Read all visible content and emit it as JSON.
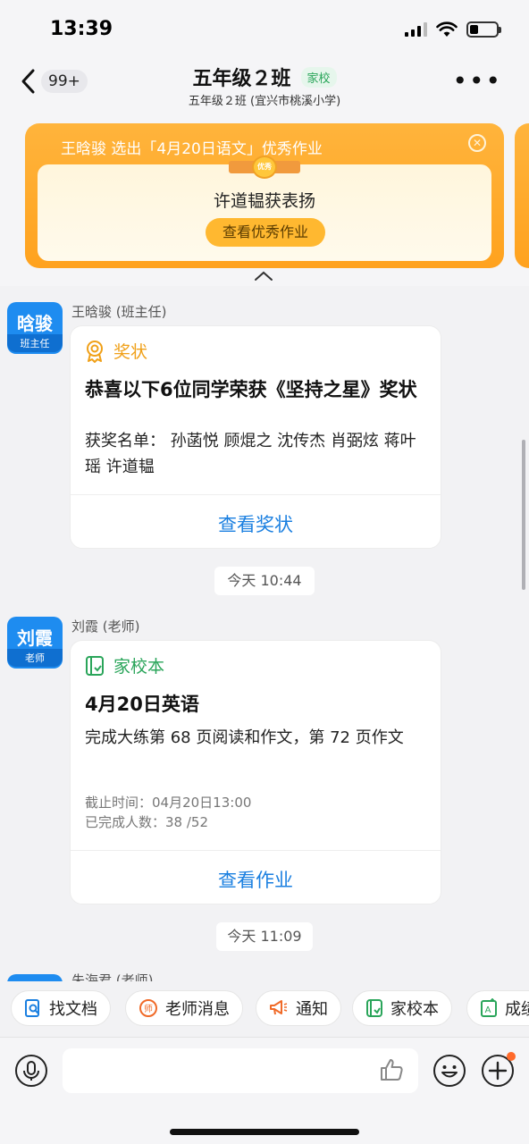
{
  "status_bar": {
    "time": "13:39"
  },
  "nav": {
    "back_badge": "99+",
    "title": "五年级２班",
    "tag": "家校",
    "subtitle": "五年级２班 (宜兴市桃溪小学)"
  },
  "banner": {
    "headline": "王晗骏 选出「4月20日语文」优秀作业",
    "ribbon_label": "优秀",
    "praise": "许道韫获表扬",
    "button_label": "查看优秀作业"
  },
  "messages": [
    {
      "avatar_name": "晗骏",
      "avatar_role": "班主任",
      "sender": "王晗骏 (班主任)",
      "card_type": "奖状",
      "type_color": "#f0a018",
      "title": "恭喜以下6位同学荣获《坚持之星》奖状",
      "body": "获奖名单：  孙菡悦  顾焜之  沈传杰  肖弼炫  蒋叶瑶  许道韫",
      "action": "查看奖状"
    },
    {
      "avatar_name": "刘霞",
      "avatar_role": "老师",
      "sender": "刘霞 (老师)",
      "card_type": "家校本",
      "type_color": "#2aa55a",
      "title": "4月20日英语",
      "body": "完成大练第 68 页阅读和作文，第 72 页作文",
      "deadline": "截止时间：04月20日13:00",
      "completed": "已完成人数：38 /52",
      "action": "查看作业"
    }
  ],
  "timestamps": [
    "今天 10:44",
    "今天 11:09"
  ],
  "partial_sender": "朱海君 (老师)",
  "quick_actions": [
    {
      "label": "找文档",
      "color": "#1a7fe0"
    },
    {
      "label": "老师消息",
      "color": "#f06a28"
    },
    {
      "label": "通知",
      "color": "#f06a28"
    },
    {
      "label": "家校本",
      "color": "#2aa55a"
    },
    {
      "label": "成绩",
      "color": "#2aa55a"
    }
  ],
  "input": {
    "placeholder": ""
  }
}
